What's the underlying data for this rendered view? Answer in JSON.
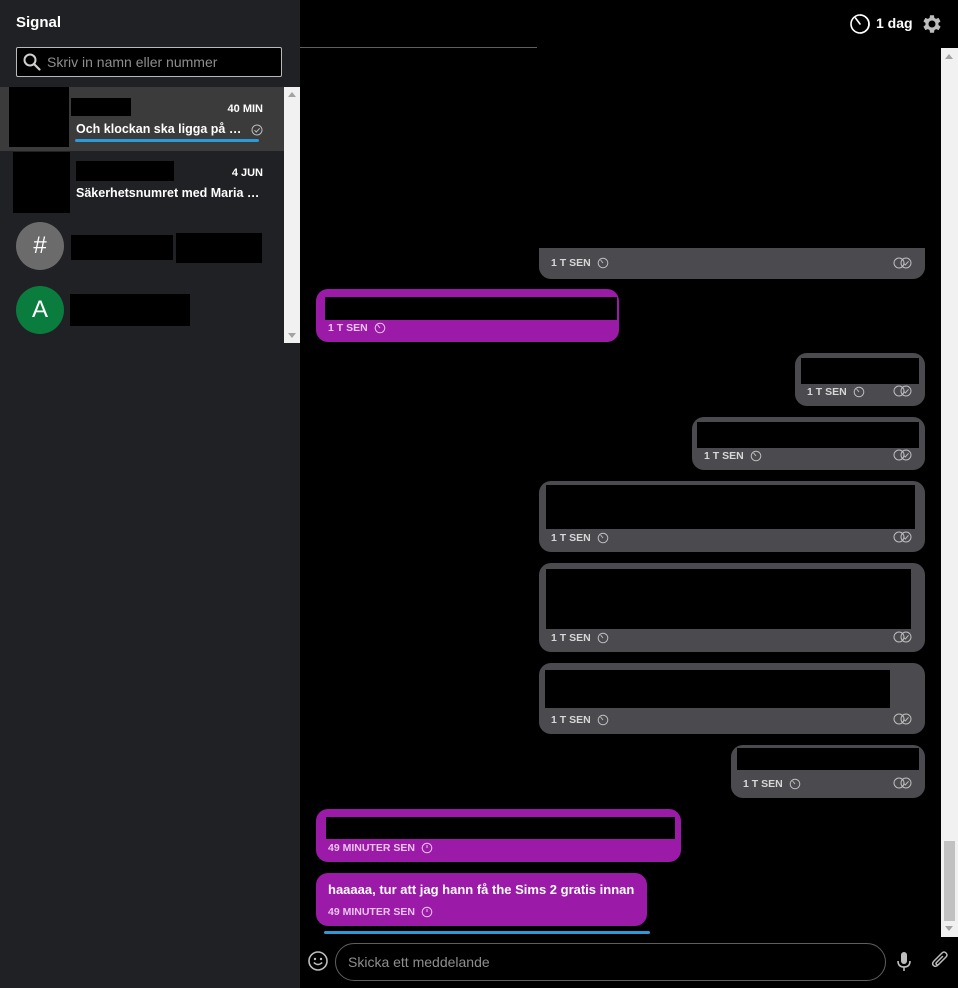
{
  "sidebar": {
    "app_title": "Signal",
    "search": {
      "placeholder": "Skriv in namn eller nummer",
      "value": ""
    },
    "conversations": [
      {
        "date": "40 MIN",
        "snippet": "Och klockan ska ligga på vä…",
        "active": true,
        "unread": true
      },
      {
        "date": "4 JUN",
        "snippet": "Säkerhetsnumret med Maria F…",
        "active": false
      },
      {
        "avatar_letter": "#",
        "avatar_color": "#6b6b6b"
      },
      {
        "avatar_letter": "A",
        "avatar_color": "#0a7d3e"
      }
    ]
  },
  "header": {
    "timer_label": "1 dag",
    "icons": [
      "timer-icon",
      "gear-icon"
    ]
  },
  "messages": [
    {
      "direction": "out",
      "time": "1 T SEN"
    },
    {
      "direction": "in",
      "time": "1 T SEN"
    },
    {
      "direction": "out",
      "time": "1 T SEN"
    },
    {
      "direction": "out",
      "time": "1 T SEN"
    },
    {
      "direction": "out",
      "time": "1 T SEN"
    },
    {
      "direction": "out",
      "time": "1 T SEN"
    },
    {
      "direction": "out",
      "time": "1 T SEN"
    },
    {
      "direction": "out",
      "time": "1 T SEN"
    },
    {
      "direction": "in",
      "time": "49 MINUTER SEN"
    },
    {
      "direction": "in",
      "time": "49 MINUTER SEN",
      "text": "haaaaa, tur att jag hann få the Sims 2 gratis innan"
    }
  ],
  "composer": {
    "placeholder": "Skicka ett meddelande",
    "value": ""
  },
  "colors": {
    "sidebar_bg": "#202124",
    "outgoing_bubble": "#4b4b4f",
    "incoming_bubble": "#9c1aa8",
    "accent_blue": "#2b9bd8"
  }
}
